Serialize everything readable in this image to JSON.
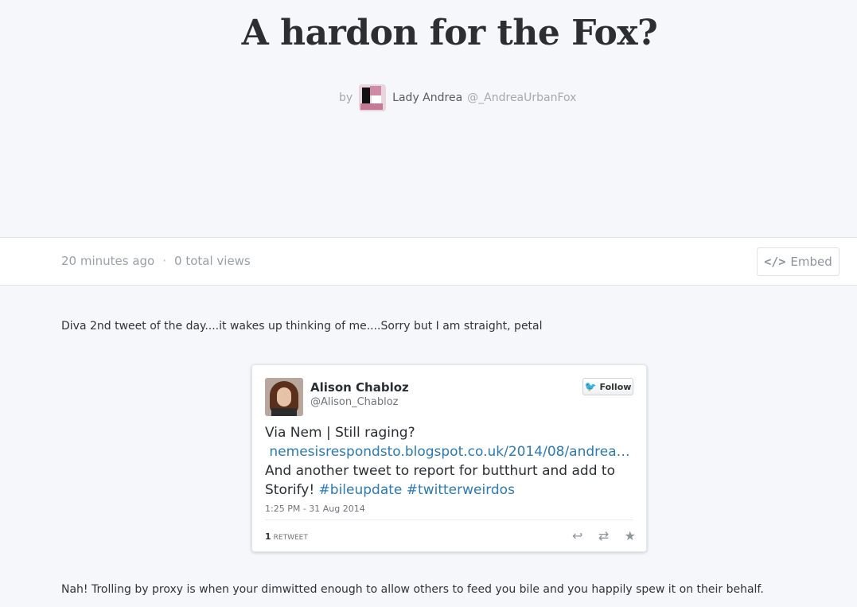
{
  "story": {
    "title": "A hardon for the Fox?",
    "by_label": "by",
    "author_name": "Lady Andrea",
    "author_handle": "@_AndreaUrbanFox"
  },
  "meta": {
    "time_ago": "20 minutes ago",
    "separator": "·",
    "views": "0 total views",
    "embed_label": "Embed",
    "embed_icon": "</>"
  },
  "paragraphs": {
    "p1": "Diva 2nd tweet of the day....it wakes up thinking of me....Sorry but I am straight, petal",
    "p2": "Nah! Trolling by proxy is when your dimwitted enough to allow others to feed you bile and you happily spew it on their behalf."
  },
  "tweet": {
    "name": "Alison Chabloz",
    "handle": "@Alison_Chabloz",
    "follow_label": "Follow",
    "text_line1": "Via Nem | Still raging?",
    "link": "nemesisrespondsto.blogspot.co.uk/2014/08/andrea…",
    "text_line3": "And another tweet to report for butthurt and add to Storify! ",
    "hashtag1": "#bileupdate",
    "hashtag2": "#twitterweirdos",
    "timestamp": "1:25 PM - 31 Aug 2014",
    "retweet_count": "1",
    "retweet_label": "RETWEET",
    "icons": [
      "reply-icon",
      "retweet-icon",
      "favorite-icon"
    ],
    "link_color": "#2a7ab8"
  }
}
